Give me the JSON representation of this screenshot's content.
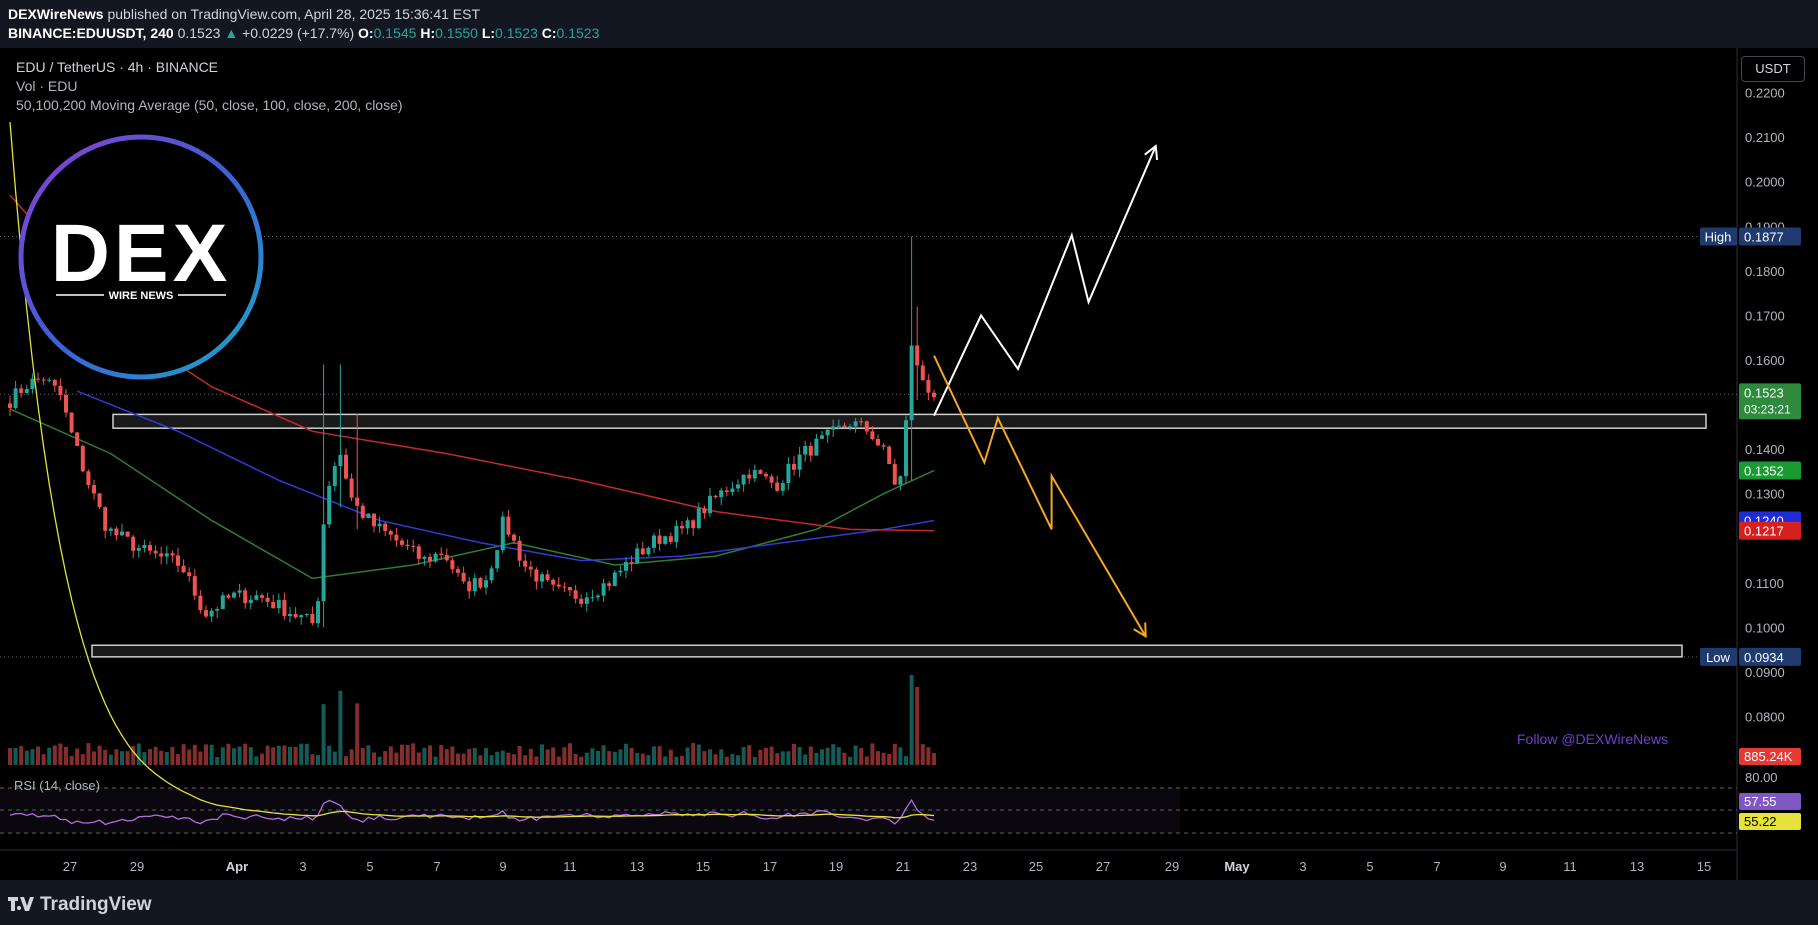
{
  "header": {
    "publisher": "DEXWireNews",
    "published_text": "published on TradingView.com, April 28, 2025 15:36:41 EST",
    "symbol": "BINANCE:EDUUSDT, 240",
    "price": "0.1523",
    "change": "+0.0229 (+17.7%)",
    "open_label": "O:",
    "open": "0.1545",
    "high_label": "H:",
    "high": "0.1550",
    "low_label": "L:",
    "low": "0.1523",
    "close_label": "C:",
    "close": "0.1523"
  },
  "legend": {
    "pair": "EDU / TetherUS · 4h · BINANCE",
    "volume": "Vol · EDU",
    "ma": "50,100,200 Moving Average (50, close, 100, close, 200, close)",
    "rsi": "RSI (14, close)"
  },
  "logo": {
    "main": "DEX",
    "sub": "WIRE NEWS"
  },
  "watermark": "Follow @DEXWireNews",
  "currency_button": "USDT",
  "footer_brand": "TradingView",
  "colors": {
    "background": "#000000",
    "up": "#26a69a",
    "down": "#ef5350",
    "ma50": "#2e7d32",
    "ma100": "#2f3bd6",
    "ma200": "#c62828",
    "projection_bull": "#ffffff",
    "projection_bear": "#f5a623",
    "rsi": "#b26edb",
    "rsi_ma": "#e4e23b"
  },
  "chart_data": {
    "type": "candlestick",
    "timeframe": "4h",
    "y_axis": {
      "ticks": [
        "0.2200",
        "0.2100",
        "0.2000",
        "0.1900",
        "0.1800",
        "0.1700",
        "0.1600",
        "0.1400",
        "0.1300",
        "0.1100",
        "0.1000",
        "0.0900",
        "0.0800"
      ],
      "ylim": [
        0.0725,
        0.23
      ]
    },
    "x_axis": {
      "tick_labels": [
        "27",
        "29",
        "Apr",
        "3",
        "5",
        "7",
        "9",
        "11",
        "13",
        "15",
        "17",
        "19",
        "21",
        "23",
        "25",
        "27",
        "29",
        "May",
        "3",
        "5",
        "7",
        "9",
        "11",
        "13",
        "15"
      ]
    },
    "price_labels": [
      {
        "tag": "High",
        "value": "0.1877"
      },
      {
        "tag": "",
        "value": "0.1523",
        "sub": "03:23:21"
      },
      {
        "tag": "",
        "value": "0.1352"
      },
      {
        "tag": "",
        "value": "0.1240"
      },
      {
        "tag": "",
        "value": "0.1217"
      },
      {
        "tag": "Low",
        "value": "0.0934"
      }
    ],
    "volume_label": "885.24K",
    "rsi_axis_label": "80.00",
    "rsi_values": {
      "rsi": "57.55",
      "rsi_ma": "55.22"
    },
    "zones": [
      {
        "name": "resistance",
        "from": 0.1447,
        "to": 0.1478
      },
      {
        "name": "support",
        "from": 0.0934,
        "to": 0.096
      }
    ],
    "anchors": [
      {
        "day": 0.0,
        "price": 0.151
      },
      {
        "day": 0.5,
        "price": 0.1545
      },
      {
        "day": 1.0,
        "price": 0.156
      },
      {
        "day": 1.5,
        "price": 0.152
      },
      {
        "day": 1.8,
        "price": 0.144
      },
      {
        "day": 2.3,
        "price": 0.133
      },
      {
        "day": 2.9,
        "price": 0.122
      },
      {
        "day": 4.0,
        "price": 0.117
      },
      {
        "day": 5.1,
        "price": 0.114
      },
      {
        "day": 5.8,
        "price": 0.103
      },
      {
        "day": 6.6,
        "price": 0.107
      },
      {
        "day": 7.4,
        "price": 0.107
      },
      {
        "day": 8.2,
        "price": 0.104
      },
      {
        "day": 9.1,
        "price": 0.1005
      },
      {
        "day": 9.4,
        "price": 0.13
      },
      {
        "day": 9.8,
        "price": 0.14
      },
      {
        "day": 10.2,
        "price": 0.128
      },
      {
        "day": 10.8,
        "price": 0.123
      },
      {
        "day": 11.4,
        "price": 0.12
      },
      {
        "day": 12.3,
        "price": 0.115
      },
      {
        "day": 12.9,
        "price": 0.117
      },
      {
        "day": 13.5,
        "price": 0.109
      },
      {
        "day": 14.2,
        "price": 0.111
      },
      {
        "day": 14.7,
        "price": 0.124
      },
      {
        "day": 15.3,
        "price": 0.114
      },
      {
        "day": 16.2,
        "price": 0.108
      },
      {
        "day": 17.0,
        "price": 0.107
      },
      {
        "day": 17.8,
        "price": 0.11
      },
      {
        "day": 18.6,
        "price": 0.116
      },
      {
        "day": 19.3,
        "price": 0.12
      },
      {
        "day": 20.1,
        "price": 0.122
      },
      {
        "day": 20.7,
        "price": 0.127
      },
      {
        "day": 21.3,
        "price": 0.131
      },
      {
        "day": 22.0,
        "price": 0.135
      },
      {
        "day": 22.8,
        "price": 0.132
      },
      {
        "day": 23.6,
        "price": 0.139
      },
      {
        "day": 24.4,
        "price": 0.143
      },
      {
        "day": 25.0,
        "price": 0.146
      },
      {
        "day": 25.6,
        "price": 0.144
      },
      {
        "day": 26.1,
        "price": 0.138
      },
      {
        "day": 26.4,
        "price": 0.131
      },
      {
        "day": 26.6,
        "price": 0.136
      },
      {
        "day": 26.8,
        "price": 0.165
      },
      {
        "day": 27.0,
        "price": 0.158
      },
      {
        "day": 27.3,
        "price": 0.154
      },
      {
        "day": 27.5,
        "price": 0.1523
      }
    ],
    "spikes": [
      {
        "day": 9.4,
        "high": 0.159,
        "low": 0.1
      },
      {
        "day": 9.9,
        "high": 0.159,
        "low": 0.127
      },
      {
        "day": 10.3,
        "high": 0.148,
        "low": 0.122
      },
      {
        "day": 26.8,
        "high": 0.1877,
        "low": 0.133
      },
      {
        "day": 27.0,
        "high": 0.172,
        "low": 0.151
      }
    ],
    "moving_averages": {
      "ma50": [
        [
          0,
          0.149
        ],
        [
          3,
          0.139
        ],
        [
          6,
          0.124
        ],
        [
          9,
          0.111
        ],
        [
          12,
          0.114
        ],
        [
          15,
          0.119
        ],
        [
          18,
          0.114
        ],
        [
          21,
          0.116
        ],
        [
          24,
          0.122
        ],
        [
          26,
          0.13
        ],
        [
          27.5,
          0.1352
        ]
      ],
      "ma100": [
        [
          2,
          0.153
        ],
        [
          5,
          0.144
        ],
        [
          8,
          0.133
        ],
        [
          11,
          0.124
        ],
        [
          14,
          0.119
        ],
        [
          17,
          0.115
        ],
        [
          20,
          0.116
        ],
        [
          23,
          0.119
        ],
        [
          26,
          0.122
        ],
        [
          27.5,
          0.124
        ]
      ],
      "ma200": [
        [
          0,
          0.197
        ],
        [
          2,
          0.18
        ],
        [
          4,
          0.164
        ],
        [
          6,
          0.154
        ],
        [
          9,
          0.144
        ],
        [
          13,
          0.139
        ],
        [
          17,
          0.133
        ],
        [
          21,
          0.126
        ],
        [
          25,
          0.122
        ],
        [
          27.5,
          0.1217
        ]
      ]
    },
    "projections": {
      "bullish": [
        [
          27.5,
          0.1475
        ],
        [
          28.9,
          0.17
        ],
        [
          30.0,
          0.158
        ],
        [
          31.6,
          0.188
        ],
        [
          32.1,
          0.173
        ],
        [
          34.1,
          0.208
        ]
      ],
      "bearish": [
        [
          27.5,
          0.161
        ],
        [
          29.0,
          0.137
        ],
        [
          29.4,
          0.147
        ],
        [
          31.0,
          0.122
        ],
        [
          31.0,
          0.134
        ],
        [
          33.8,
          0.098
        ]
      ]
    }
  }
}
